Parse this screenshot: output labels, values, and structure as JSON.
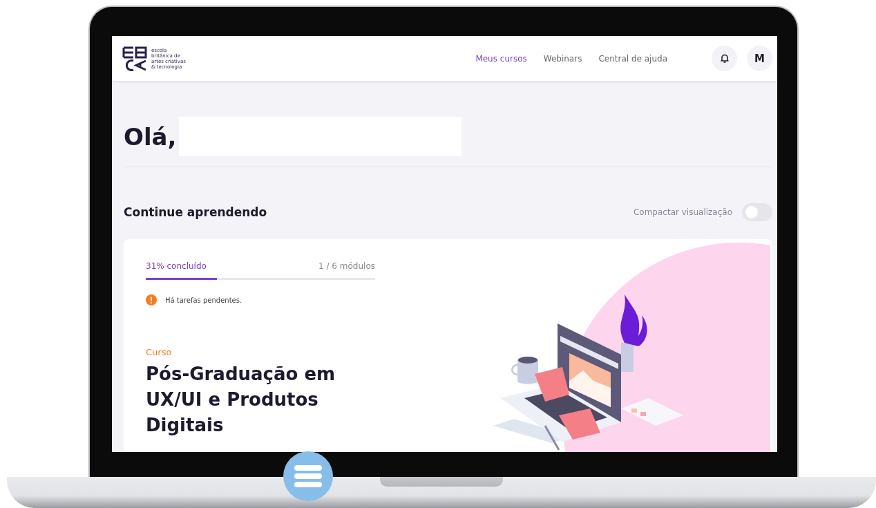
{
  "header": {
    "logo_text": "escola\nbritânica de\nartes criativas\n& tecnologia",
    "nav": [
      {
        "label": "Meus cursos",
        "selected": true
      },
      {
        "label": "Webinars",
        "selected": false
      },
      {
        "label": "Central de ajuda",
        "selected": false
      }
    ],
    "avatar": "M"
  },
  "greeting": "Olá,",
  "section": {
    "title": "Continue aprendendo",
    "toggle": {
      "label": "Compactar visualização",
      "on": false
    }
  },
  "course_card": {
    "progress_label": "31% concluído",
    "modules": "1 / 6 módulos",
    "level": 0.31,
    "alert": "Há tarefas pendentes.",
    "category": "Curso",
    "title": "Pós-Graduação em UX/UI e Produtos Digitais"
  }
}
